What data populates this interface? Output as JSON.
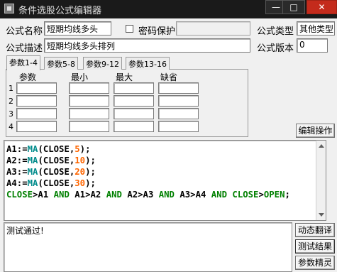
{
  "window": {
    "title": "条件选股公式编辑器",
    "min_glyph": "—",
    "max_glyph": "□",
    "close_glyph": "✕"
  },
  "form": {
    "name_label": "公式名称",
    "name_value": "短期均线多头",
    "password_label": "密码保护",
    "password_checked": false,
    "password_value": "",
    "type_label": "公式类型",
    "type_value": "其他类型",
    "desc_label": "公式描述",
    "desc_value": "短期均线多头排列",
    "version_label": "公式版本",
    "version_value": "0"
  },
  "tabs": [
    {
      "label": "参数1-4",
      "active": true
    },
    {
      "label": "参数5-8",
      "active": false
    },
    {
      "label": "参数9-12",
      "active": false
    },
    {
      "label": "参数13-16",
      "active": false
    }
  ],
  "param_table": {
    "headers": [
      "参数",
      "最小",
      "最大",
      "缺省"
    ],
    "rows": [
      "1",
      "2",
      "3",
      "4"
    ]
  },
  "buttons": {
    "edit_ops": "编辑操作",
    "dynamic_translate": "动态翻译",
    "test_result": "测试结果",
    "param_wizard": "参数精灵"
  },
  "code_lines": [
    "A1:=MA(CLOSE,5);",
    "A2:=MA(CLOSE,10);",
    "A3:=MA(CLOSE,20);",
    "A4:=MA(CLOSE,30);",
    "CLOSE>A1 AND A1>A2 AND A2>A3 AND A3>A4 AND CLOSE>OPEN;"
  ],
  "message": "测试通过!"
}
